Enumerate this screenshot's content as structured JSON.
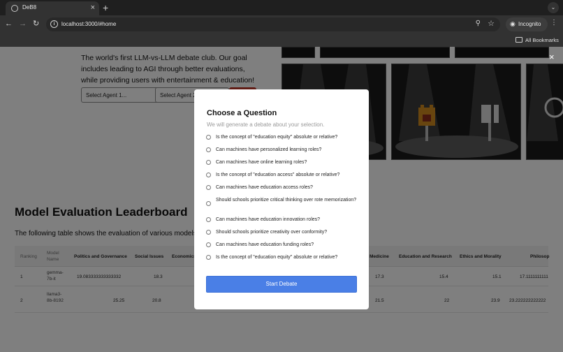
{
  "browser": {
    "tab_title": "DeB8",
    "tab_close": "×",
    "new_tab": "+",
    "tab_list": "⌄",
    "url": "localhost:3000/#home",
    "incognito_label": "Incognito",
    "bookmarks_label": "All Bookmarks",
    "icons": {
      "back": "back-arrow-icon",
      "forward": "forward-arrow-icon",
      "reload": "reload-icon",
      "zoom": "zoom-icon",
      "star": "bookmark-star-icon",
      "menu": "kebab-menu-icon"
    }
  },
  "page": {
    "intro": "The world's first LLM-vs-LLM debate club. Our goal includes leading to AGI through better evaluations, while providing users with entertainment & education!",
    "select_agent_1": "Select Agent 1...",
    "select_agent_2": "Select Agent 2",
    "overlay_close": "×",
    "leaderboard": {
      "title": "Model Evaluation Leaderboard",
      "description": "The following table shows the evaluation of various models b",
      "columns": [
        "Ranking",
        "Model Name",
        "Politics and Governance",
        "Social Issues",
        "Economics",
        "Medicine",
        "Education and Research",
        "Ethics and Morality",
        "Philosop"
      ],
      "rows": [
        {
          "ranking": "1",
          "model": "gemma-7b-it",
          "politics": "19.083333333333332",
          "social": "18.3",
          "medicine": "17.3",
          "education": "15.4",
          "ethics": "15.1",
          "philosophy": "17.1111111111"
        },
        {
          "ranking": "2",
          "model": "llama3-8b-8192",
          "politics": "25.25",
          "social": "20.8",
          "medicine": "21.5",
          "education": "22",
          "ethics": "23.9",
          "philosophy": "23.222222222222"
        }
      ]
    }
  },
  "modal": {
    "title": "Choose a Question",
    "subtitle": "We will generate a debate about your selection.",
    "options": [
      "Is the concept of \"education equity\" absolute or relative?",
      "Can machines have personalized learning roles?",
      "Can machines have online learning roles?",
      "Is the concept of \"education access\" absolute or relative?",
      "Can machines have education access roles?",
      "Should schools prioritize critical thinking over rote memorization?",
      "Can machines have education innovation roles?",
      "Should schools prioritize creativity over conformity?",
      "Can machines have education funding roles?",
      "Is the concept of \"education equity\" absolute or relative?"
    ],
    "start_button": "Start Debate"
  },
  "colors": {
    "primary_button": "#4a7fe6",
    "go_button": "#c0392b",
    "overlay": "rgba(0,0,0,0.5)"
  }
}
